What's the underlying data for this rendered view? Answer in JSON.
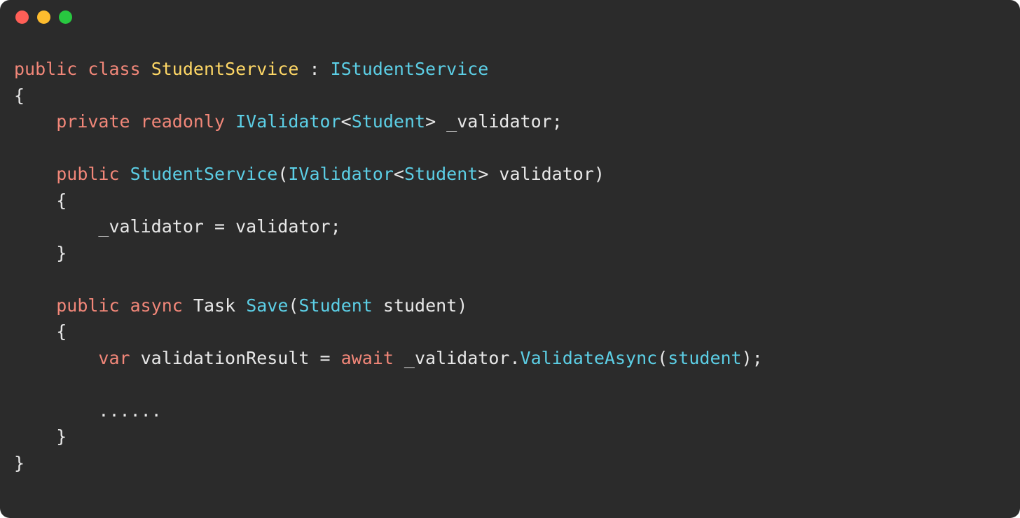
{
  "titlebar": {
    "buttons": [
      "close",
      "minimize",
      "zoom"
    ]
  },
  "code": {
    "tokens": {
      "l1_public": "public",
      "l1_class": "class",
      "l1_name": "StudentService",
      "l1_colon": " : ",
      "l1_iface": "IStudentService",
      "l2_brace": "{",
      "l3_private": "private",
      "l3_readonly": "readonly",
      "l3_ivalidator": "IValidator",
      "l3_lt": "<",
      "l3_student": "Student",
      "l3_gt": ">",
      "l3_field": " _validator",
      "l3_semi": ";",
      "l5_public": "public",
      "l5_ctor": "StudentService",
      "l5_lp": "(",
      "l5_ivalidator": "IValidator",
      "l5_lt": "<",
      "l5_student": "Student",
      "l5_gt": ">",
      "l5_param": " validator",
      "l5_rp": ")",
      "l6_brace": "{",
      "l7_assign_lhs": "_validator",
      "l7_eq": " = ",
      "l7_assign_rhs": "validator",
      "l7_semi": ";",
      "l8_brace": "}",
      "l10_public": "public",
      "l10_async": "async",
      "l10_task": "Task",
      "l10_method": "Save",
      "l10_lp": "(",
      "l10_student": "Student",
      "l10_param": " student",
      "l10_rp": ")",
      "l11_brace": "{",
      "l12_var": "var",
      "l12_resvar": " validationResult",
      "l12_eq": " = ",
      "l12_await": "await",
      "l12_target": " _validator",
      "l12_dot": ".",
      "l12_call": "ValidateAsync",
      "l12_lp": "(",
      "l12_arg": "student",
      "l12_rp": ")",
      "l12_semi": ";",
      "l14_dots": "......",
      "l15_brace": "}",
      "l16_brace": "}"
    }
  }
}
